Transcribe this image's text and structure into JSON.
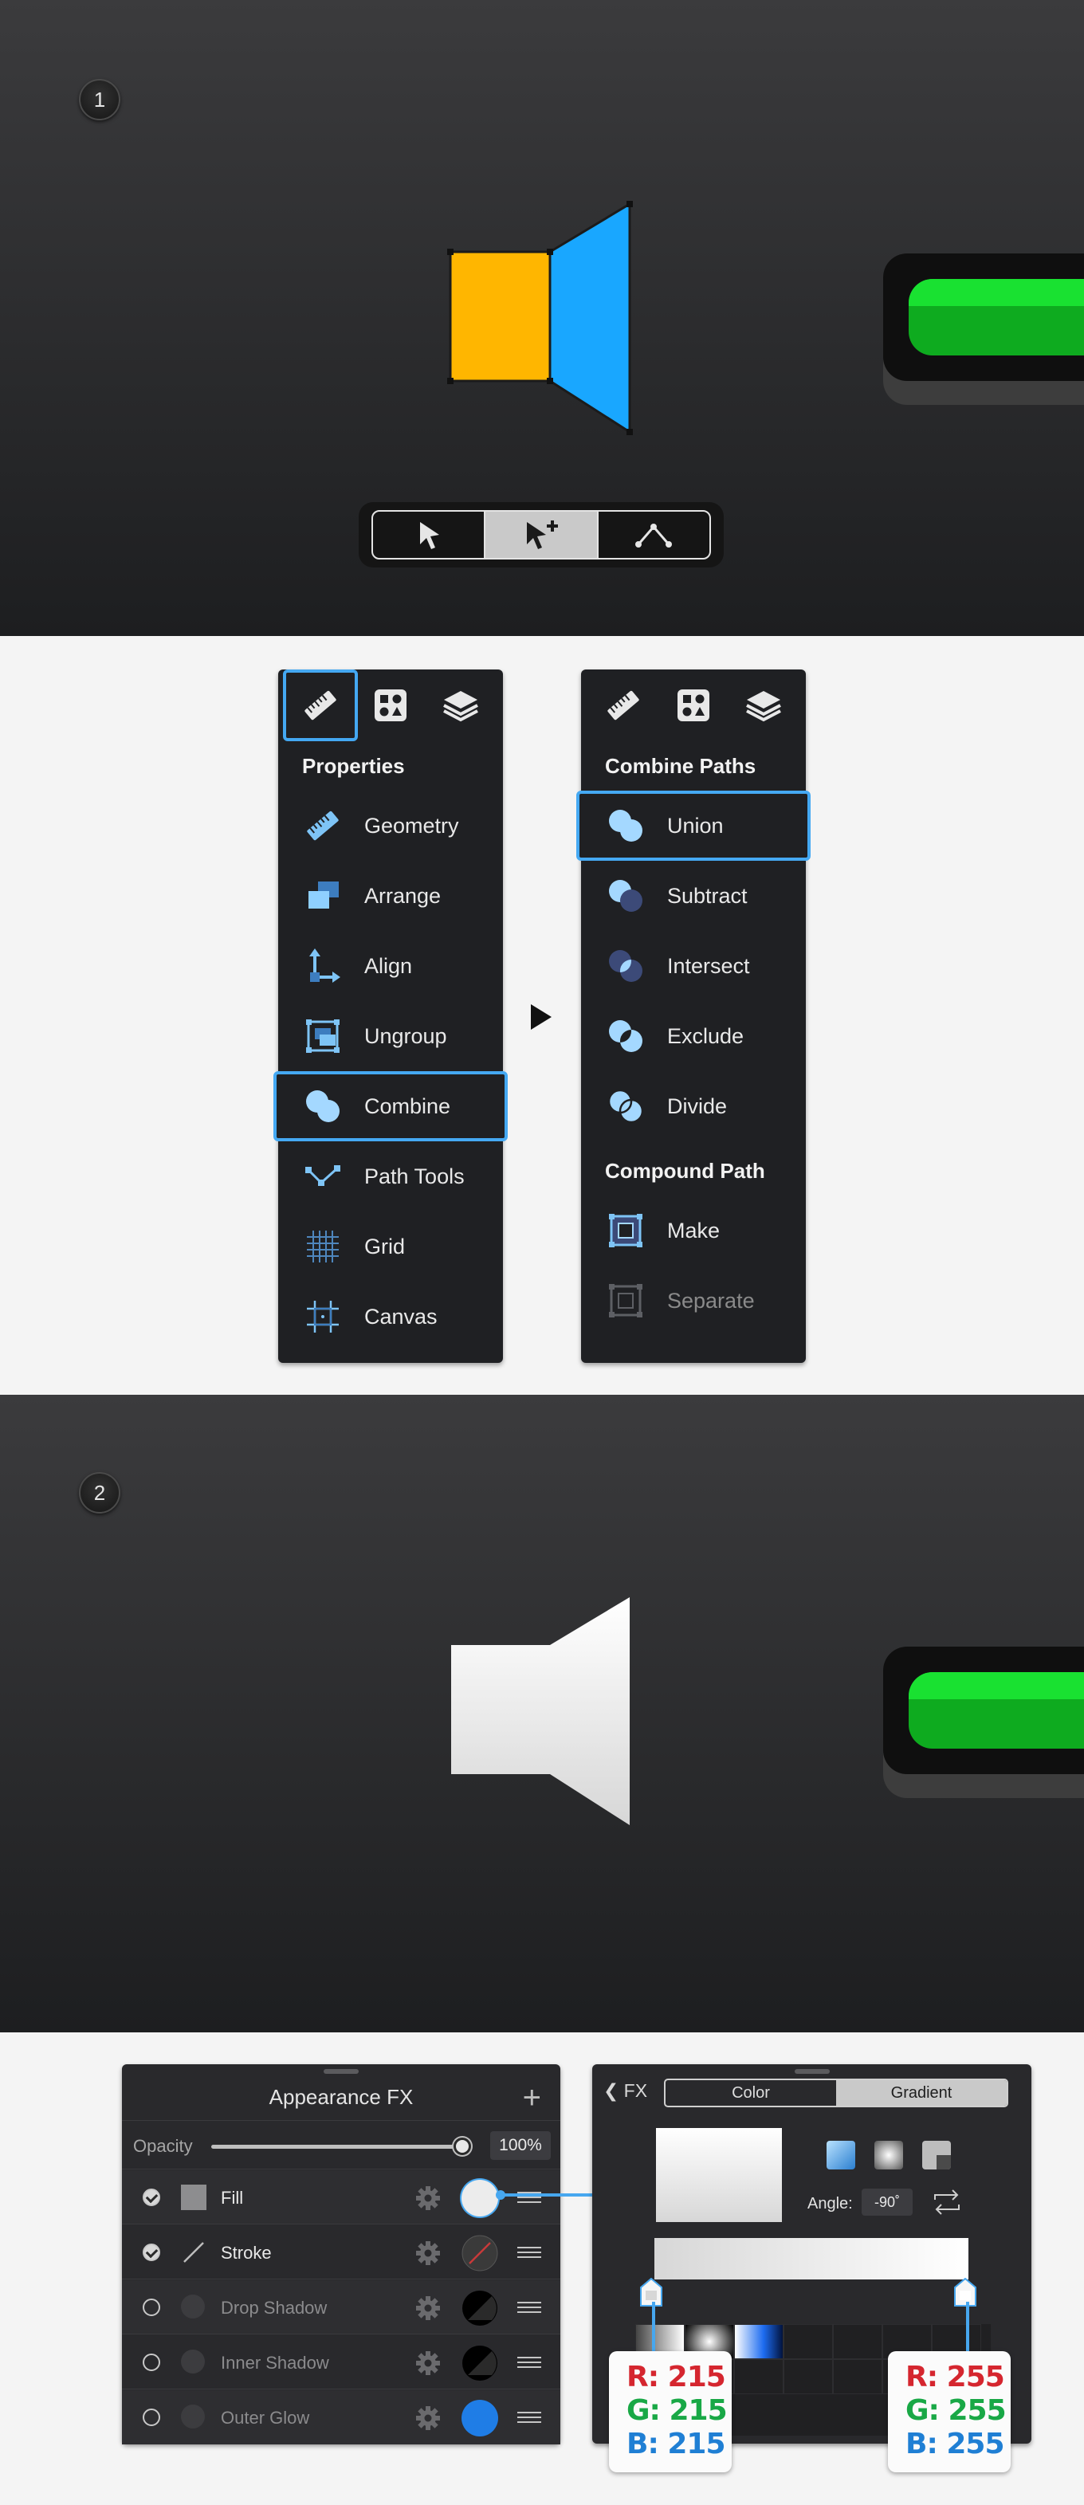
{
  "step1": {
    "badge": "1"
  },
  "step2": {
    "badge": "2"
  },
  "colors": {
    "accent": "#45a9f3",
    "orange": "#ffb600",
    "blue": "#19a7ff",
    "green": "#19e131"
  },
  "selection_tools": [
    {
      "name": "select",
      "icon": "arrow-cursor-icon",
      "active": false
    },
    {
      "name": "select-add",
      "icon": "arrow-cursor-plus-icon",
      "active": true
    },
    {
      "name": "node",
      "icon": "node-path-icon",
      "active": false
    }
  ],
  "properties_panel": {
    "tabs": [
      "ruler-icon",
      "shapes-icon",
      "layers-icon"
    ],
    "title": "Properties",
    "items": [
      {
        "label": "Geometry",
        "icon": "ruler-icon"
      },
      {
        "label": "Arrange",
        "icon": "arrange-icon"
      },
      {
        "label": "Align",
        "icon": "align-icon"
      },
      {
        "label": "Ungroup",
        "icon": "ungroup-icon"
      },
      {
        "label": "Combine",
        "icon": "combine-icon"
      },
      {
        "label": "Path Tools",
        "icon": "path-tools-icon"
      },
      {
        "label": "Grid",
        "icon": "grid-icon"
      },
      {
        "label": "Canvas",
        "icon": "canvas-icon"
      }
    ]
  },
  "combine_panel": {
    "title": "Combine Paths",
    "items": [
      {
        "label": "Union",
        "icon": "union-icon"
      },
      {
        "label": "Subtract",
        "icon": "subtract-icon"
      },
      {
        "label": "Intersect",
        "icon": "intersect-icon"
      },
      {
        "label": "Exclude",
        "icon": "exclude-icon"
      },
      {
        "label": "Divide",
        "icon": "divide-icon"
      }
    ],
    "compound_title": "Compound Path",
    "compound_items": [
      {
        "label": "Make",
        "icon": "make-compound-icon"
      },
      {
        "label": "Separate",
        "icon": "separate-compound-icon"
      }
    ]
  },
  "appearance": {
    "title": "Appearance FX",
    "add": "+",
    "opacity_label": "Opacity",
    "opacity_value": "100%",
    "opacity_level": 1.0,
    "rows": [
      {
        "label": "Fill",
        "enabled": true,
        "swatch": "#ececec"
      },
      {
        "label": "Stroke",
        "enabled": true,
        "swatch": "#3a3a3a"
      },
      {
        "label": "Drop Shadow",
        "enabled": false,
        "swatch": "#000000"
      },
      {
        "label": "Inner Shadow",
        "enabled": false,
        "swatch": "#000000"
      },
      {
        "label": "Outer Glow",
        "enabled": false,
        "swatch": "#1f7de6"
      }
    ]
  },
  "gradient": {
    "back_label": "FX",
    "tab_color": "Color",
    "tab_gradient": "Gradient",
    "angle_label": "Angle:",
    "angle_value": "-90˚",
    "start": {
      "r": "R: 215",
      "g": "G: 215",
      "b": "B: 215"
    },
    "end": {
      "r": "R: 255",
      "g": "G: 255",
      "b": "B: 255"
    }
  }
}
